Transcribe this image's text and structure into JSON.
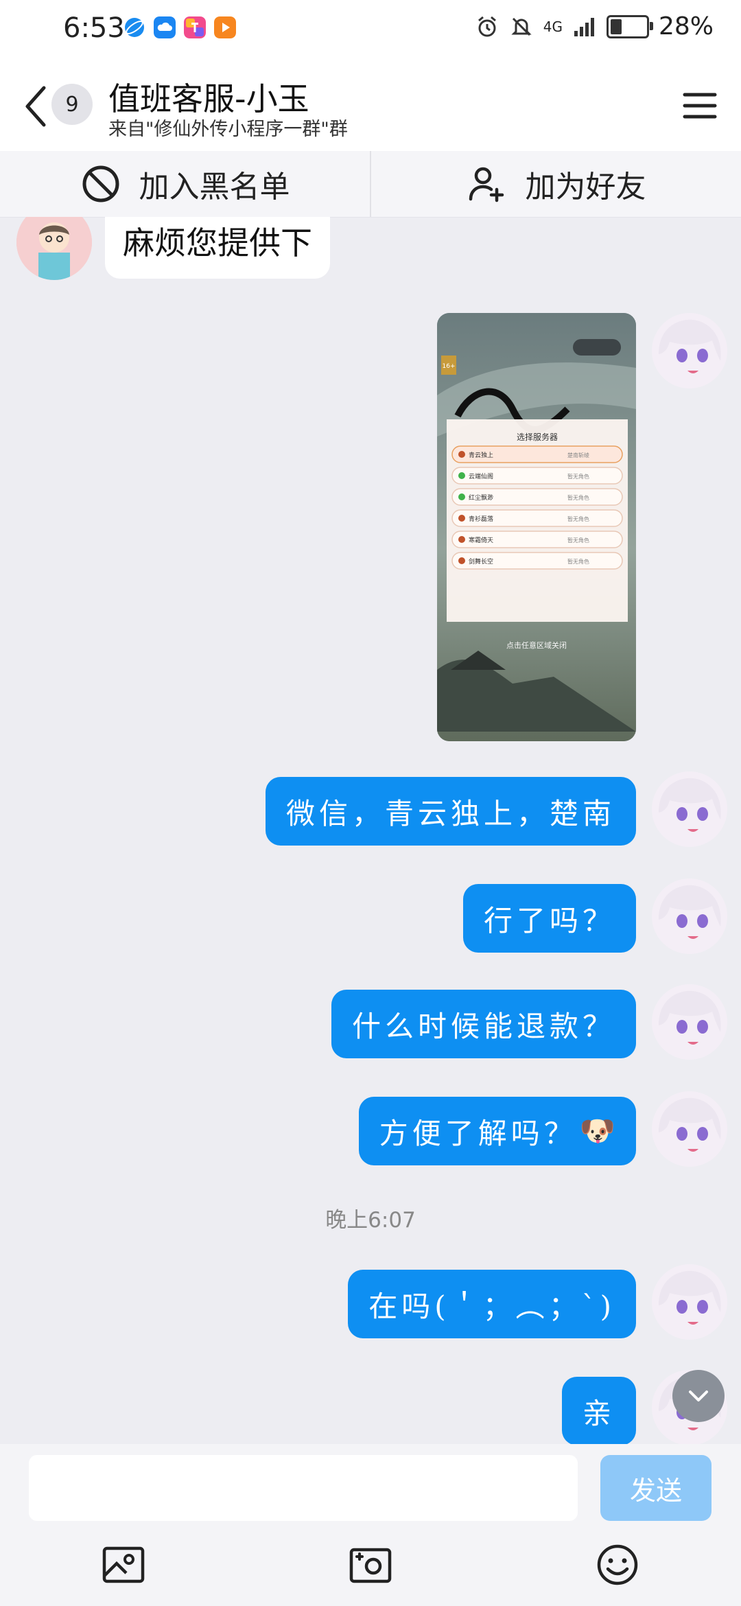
{
  "status_bar": {
    "time": "6:53",
    "network": "4G",
    "battery_percent": "28%",
    "battery_level": 0.28
  },
  "header": {
    "back_icon": "chevron-left-icon",
    "unread_count": "9",
    "title": "值班客服-小玉",
    "subtitle": "来自\"修仙外传小程序一群\"群",
    "menu_icon": "hamburger-menu-icon"
  },
  "actions": {
    "block_label": "加入黑名单",
    "add_friend_label": "加为好友"
  },
  "messages": {
    "incoming_1": "麻烦您提供下",
    "outgoing_1": "微信，青云独上，楚南",
    "outgoing_2": "行了吗？",
    "outgoing_3": "什么时候能退款？",
    "outgoing_4": "方便了解吗？",
    "outgoing_4_emoji": "🐶",
    "timestamp": "晚上6:07",
    "outgoing_5": "在吗(＇；︵；`)",
    "outgoing_6": "亲"
  },
  "screenshot_image": {
    "dialog_title": "选择服务器",
    "rows": [
      {
        "server": "青云独上",
        "role": "楚南斩绫",
        "dot_color": "#c0522a"
      },
      {
        "server": "云端仙阁",
        "role": "暂无角色",
        "dot_color": "#3fb24a"
      },
      {
        "server": "红尘飘渺",
        "role": "暂无角色",
        "dot_color": "#3fb24a"
      },
      {
        "server": "青衫磊落",
        "role": "暂无角色",
        "dot_color": "#c0522a"
      },
      {
        "server": "寒霜倚天",
        "role": "暂无角色",
        "dot_color": "#c0522a"
      },
      {
        "server": "剑舞长空",
        "role": "暂无角色",
        "dot_color": "#c0522a"
      }
    ],
    "close_hint": "点击任意区域关闭",
    "age_badge": "16+"
  },
  "input": {
    "value": "",
    "send_label": "发送"
  },
  "colors": {
    "accent": "#0e8ff2",
    "send_disabled": "#8ec8f8",
    "background": "#ededf2"
  }
}
